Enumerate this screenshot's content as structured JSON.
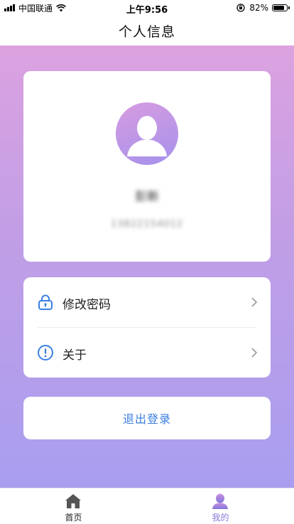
{
  "status_bar": {
    "carrier": "中国联通",
    "time": "上午9:56",
    "battery": "82%"
  },
  "header": {
    "title": "个人信息"
  },
  "profile": {
    "name": "彭新",
    "phone": "13822154012"
  },
  "menu": {
    "items": [
      {
        "label": "修改密码",
        "icon": "lock-icon"
      },
      {
        "label": "关于",
        "icon": "info-icon"
      }
    ]
  },
  "logout": {
    "label": "退出登录"
  },
  "tab_bar": {
    "tabs": [
      {
        "label": "首页",
        "icon": "home-icon",
        "active": false
      },
      {
        "label": "我的",
        "icon": "user-icon",
        "active": true
      }
    ]
  },
  "colors": {
    "accent": "#3a7ee0",
    "active_tab": "#8a78d8",
    "gradient_top": "#dca2e0",
    "gradient_bottom": "#a99ef0"
  }
}
